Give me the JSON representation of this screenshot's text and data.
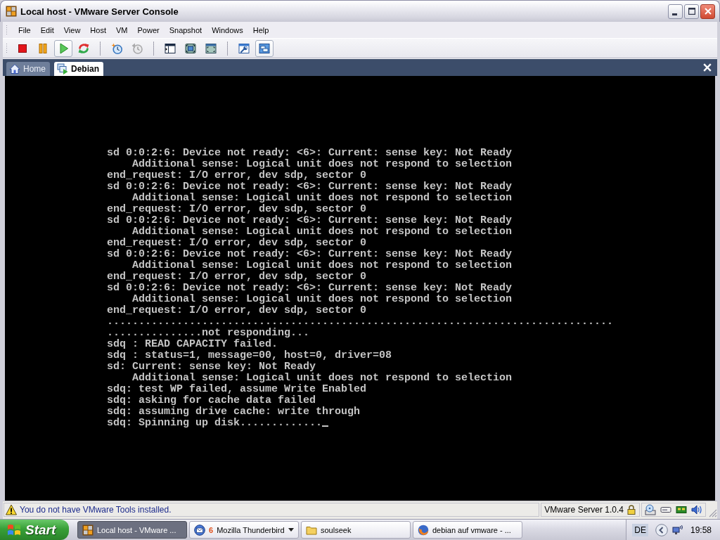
{
  "window": {
    "title": "Local host - VMware Server Console"
  },
  "menu": [
    "File",
    "Edit",
    "View",
    "Host",
    "VM",
    "Power",
    "Snapshot",
    "Windows",
    "Help"
  ],
  "toolbar": {
    "groups": [
      [
        {
          "kind": "stop",
          "selected": false,
          "disabled": false
        },
        {
          "kind": "pause",
          "selected": false,
          "disabled": false
        },
        {
          "kind": "play",
          "selected": true,
          "disabled": false
        },
        {
          "kind": "reset",
          "selected": false,
          "disabled": false
        }
      ],
      [
        {
          "kind": "snapshot",
          "selected": false,
          "disabled": false
        },
        {
          "kind": "revert",
          "selected": false,
          "disabled": true
        }
      ],
      [
        {
          "kind": "sidebar",
          "selected": false,
          "disabled": false
        },
        {
          "kind": "fullscreen",
          "selected": false,
          "disabled": false
        },
        {
          "kind": "quickswitch",
          "selected": false,
          "disabled": false
        }
      ],
      [
        {
          "kind": "settings",
          "selected": false,
          "disabled": false
        },
        {
          "kind": "console",
          "selected": true,
          "disabled": false
        }
      ]
    ]
  },
  "tabs": [
    {
      "label": "Home",
      "kind": "home",
      "selected": false
    },
    {
      "label": "Debian",
      "kind": "vm",
      "selected": true
    }
  ],
  "console": {
    "lines": [
      "sd 0:0:2:6: Device not ready: <6>: Current: sense key: Not Ready",
      "    Additional sense: Logical unit does not respond to selection",
      "end_request: I/O error, dev sdp, sector 0",
      "sd 0:0:2:6: Device not ready: <6>: Current: sense key: Not Ready",
      "    Additional sense: Logical unit does not respond to selection",
      "end_request: I/O error, dev sdp, sector 0",
      "sd 0:0:2:6: Device not ready: <6>: Current: sense key: Not Ready",
      "    Additional sense: Logical unit does not respond to selection",
      "end_request: I/O error, dev sdp, sector 0",
      "sd 0:0:2:6: Device not ready: <6>: Current: sense key: Not Ready",
      "    Additional sense: Logical unit does not respond to selection",
      "end_request: I/O error, dev sdp, sector 0",
      "sd 0:0:2:6: Device not ready: <6>: Current: sense key: Not Ready",
      "    Additional sense: Logical unit does not respond to selection",
      "end_request: I/O error, dev sdp, sector 0",
      "................................................................................",
      "...............not responding...",
      "sdq : READ CAPACITY failed.",
      "sdq : status=1, message=00, host=0, driver=08",
      "sd: Current: sense key: Not Ready",
      "    Additional sense: Logical unit does not respond to selection",
      "sdq: test WP failed, assume Write Enabled",
      "sdq: asking for cache data failed",
      "sdq: assuming drive cache: write through",
      "sdq: Spinning up disk............."
    ],
    "cursor": true
  },
  "status_bar": {
    "message": "You do not have VMware Tools installed.",
    "version": "VMware Server 1.0.4"
  },
  "taskbar": {
    "start": "Start",
    "tasks": [
      {
        "label": "Local host - VMware ...",
        "kind": "vmware",
        "selected": true
      },
      {
        "label": "Mozilla Thunderbird",
        "kind": "thunderbird",
        "badge": "6",
        "selected": false
      },
      {
        "label": "soulseek",
        "kind": "folder",
        "selected": false
      },
      {
        "label": "debian auf vmware - ...",
        "kind": "firefox",
        "selected": false
      }
    ],
    "tray": {
      "language": "DE",
      "time": "19:58"
    }
  }
}
